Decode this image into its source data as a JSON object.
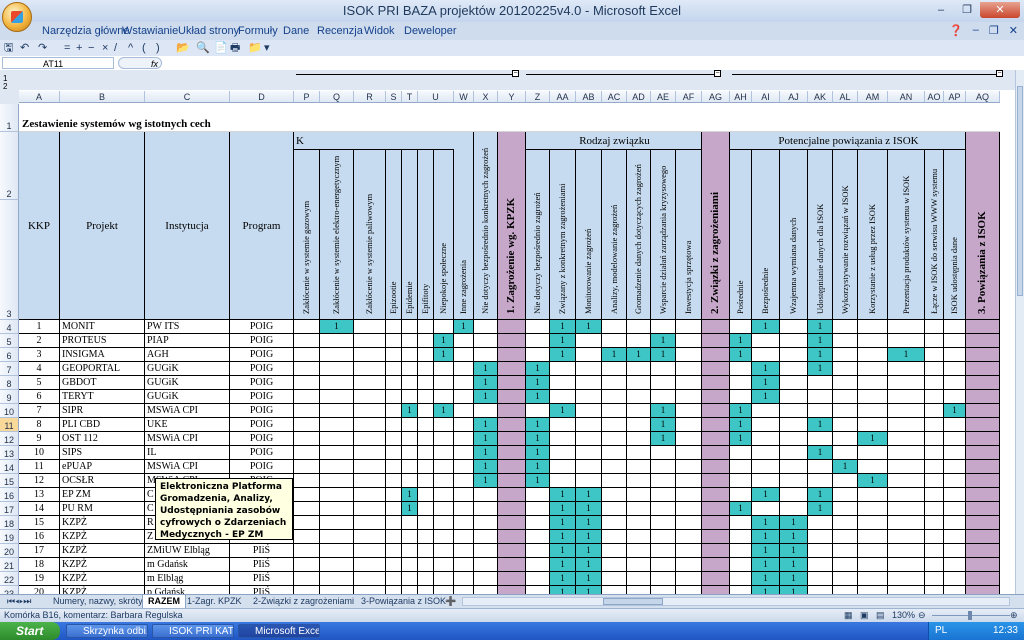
{
  "window": {
    "title": "ISOK PRI BAZA projektów 20120225v4.0 - Microsoft Excel"
  },
  "ribbon": {
    "tabs": [
      "Narzędzia główne",
      "Wstawianie",
      "Układ strony",
      "Formuły",
      "Dane",
      "Recenzja",
      "Widok",
      "Deweloper"
    ]
  },
  "formula_bar": {
    "name_box": "AT11",
    "fx": "fx",
    "value": ""
  },
  "columns": [
    "A",
    "B",
    "C",
    "D",
    "P",
    "Q",
    "R",
    "S",
    "T",
    "U",
    "W",
    "X",
    "Y",
    "Z",
    "AA",
    "AB",
    "AC",
    "AD",
    "AE",
    "AF",
    "AG",
    "AH",
    "AI",
    "AJ",
    "AK",
    "AL",
    "AM",
    "AN",
    "AO",
    "AP",
    "AQ"
  ],
  "outline_levels": [
    "1",
    "2"
  ],
  "rows_visible": [
    "1",
    "2",
    "3",
    "4",
    "5",
    "6",
    "7",
    "8",
    "9",
    "10",
    "11",
    "12",
    "13",
    "14",
    "15",
    "16",
    "17",
    "18",
    "19",
    "20",
    "21",
    "22",
    "23"
  ],
  "sheet": {
    "title": "Zestawienie systemów wg istotnych cech",
    "row2_groups": {
      "k_fragment": "K",
      "rodzaj": "Rodzaj związku",
      "potencjalne": "Potencjalne powiązania z ISOK"
    },
    "headers": {
      "kkp": "KKP",
      "projekt": "Projekt",
      "instytucja": "Instytucja",
      "program": "Program",
      "P": "Zakłócenie w systemie gazowym",
      "Q": "Zakłócenie w systemie elektro-energetycznym",
      "R": "Zakłócenie w systemie paliwowym",
      "S": "Epizootie",
      "T": "Epidemie",
      "U": "Epifitoty",
      "V": "Niepokoje społeczne",
      "W": "Inne zagrożenia",
      "X": "Nie dotyczy bezpośrednio konkretnych zagrożeń",
      "Y": "1. Zagrożenie wg. KPZK",
      "Z": "Nie dotyczy bezpośrednio zagrożeń",
      "AA": "Związany z konkretnym zagrożeniami",
      "AB": "Monitorowanie zagrożeń",
      "AC": "Analizy, modelowanie zagrożeń",
      "AD": "Gromadzenie danych dotyczących zagrożeń",
      "AE": "Wsparcie działań zarządzania kryzysowego",
      "AF": "Inwestycja sprzętowa",
      "AG": "2. Związki z zagrożeniami",
      "AH": "Pośrednie",
      "AI": "Bezpośrednie",
      "AJ": "Wzajemna wymiana danych",
      "AK": "Udostępnianie danych dla ISOK",
      "AL": "Wykorzystywanie rozwiązań w ISOK",
      "AM": "Korzystanie z usług przez ISOK",
      "AN": "Prezentacja produktów systemu w ISOK",
      "AO": "Łącze w ISOK do serwisu WWW systemu",
      "AP": "ISOK udostępnia dane",
      "AQ": "3. Powiązania z ISOK"
    },
    "rows": [
      {
        "kkp": "1",
        "projekt": "MONIT",
        "instytucja": "PW ITS",
        "program": "POIG",
        "flags": {
          "Q": "1",
          "W": "1",
          "AA": "1",
          "AB": "1",
          "AI": "1",
          "AK": "1"
        }
      },
      {
        "kkp": "2",
        "projekt": "PROTEUS",
        "instytucja": "PIAP",
        "program": "POIG",
        "flags": {
          "V": "1",
          "AA": "1",
          "AE": "1",
          "AH": "1",
          "AK": "1"
        }
      },
      {
        "kkp": "3",
        "projekt": "INSIGMA",
        "instytucja": "AGH",
        "program": "POIG",
        "flags": {
          "V": "1",
          "AA": "1",
          "AC": "1",
          "AD": "1",
          "AE": "1",
          "AH": "1",
          "AK": "1",
          "AN": "1"
        }
      },
      {
        "kkp": "4",
        "projekt": "GEOPORTAL",
        "instytucja": "GUGiK",
        "program": "POIG",
        "flags": {
          "X": "1",
          "Z": "1",
          "AI": "1",
          "AK": "1"
        }
      },
      {
        "kkp": "5",
        "projekt": "GBDOT",
        "instytucja": "GUGiK",
        "program": "POIG",
        "flags": {
          "X": "1",
          "Z": "1",
          "AI": "1"
        }
      },
      {
        "kkp": "6",
        "projekt": "TERYT",
        "instytucja": "GUGiK",
        "program": "POIG",
        "flags": {
          "X": "1",
          "Z": "1",
          "AI": "1"
        }
      },
      {
        "kkp": "7",
        "projekt": "SIPR",
        "instytucja": "MSWiA CPI",
        "program": "POIG",
        "flags": {
          "T": "1",
          "V": "1",
          "AA": "1",
          "AE": "1",
          "AH": "1",
          "AP": "1"
        }
      },
      {
        "kkp": "8",
        "projekt": "PLI CBD",
        "instytucja": "UKE",
        "program": "POIG",
        "flags": {
          "X": "1",
          "Z": "1",
          "AE": "1",
          "AH": "1",
          "AK": "1"
        }
      },
      {
        "kkp": "9",
        "projekt": "OST 112",
        "instytucja": "MSWiA CPI",
        "program": "POIG",
        "flags": {
          "X": "1",
          "Z": "1",
          "AE": "1",
          "AH": "1",
          "AM": "1"
        }
      },
      {
        "kkp": "10",
        "projekt": "SIPS",
        "instytucja": "IL",
        "program": "POIG",
        "flags": {
          "X": "1",
          "Z": "1",
          "AK": "1"
        }
      },
      {
        "kkp": "11",
        "projekt": "ePUAP",
        "instytucja": "MSWiA CPI",
        "program": "POIG",
        "flags": {
          "X": "1",
          "Z": "1",
          "AL": "1"
        }
      },
      {
        "kkp": "12",
        "projekt": "OCSŁR",
        "instytucja": "MSWiA CPI",
        "program": "POIG",
        "flags": {
          "X": "1",
          "Z": "1",
          "AM": "1"
        }
      },
      {
        "kkp": "13",
        "projekt": "EP ZM",
        "instytucja": "C",
        "program": "POIG",
        "flags": {
          "T": "1",
          "AA": "1",
          "AB": "1",
          "AI": "1",
          "AK": "1"
        }
      },
      {
        "kkp": "14",
        "projekt": "PU RM",
        "instytucja": "C",
        "program": "POIG",
        "flags": {
          "T": "1",
          "AA": "1",
          "AB": "1",
          "AH": "1",
          "AK": "1"
        }
      },
      {
        "kkp": "15",
        "projekt": "KZPŻ",
        "instytucja": "R",
        "program": "PIiŚ",
        "flags": {
          "AA": "1",
          "AB": "1",
          "AI": "1",
          "AJ": "1"
        }
      },
      {
        "kkp": "16",
        "projekt": "KZPŻ",
        "instytucja": "Z",
        "program": "PIiŚ",
        "flags": {
          "AA": "1",
          "AB": "1",
          "AI": "1",
          "AJ": "1"
        }
      },
      {
        "kkp": "17",
        "projekt": "KZPŻ",
        "instytucja": "ZMiUW Elbląg",
        "program": "PIiŚ",
        "flags": {
          "AA": "1",
          "AB": "1",
          "AI": "1",
          "AJ": "1"
        }
      },
      {
        "kkp": "18",
        "projekt": "KZPŻ",
        "instytucja": "m Gdańsk",
        "program": "PIiŚ",
        "flags": {
          "AA": "1",
          "AB": "1",
          "AI": "1",
          "AJ": "1"
        }
      },
      {
        "kkp": "19",
        "projekt": "KZPŻ",
        "instytucja": "m Elbląg",
        "program": "PIiŚ",
        "flags": {
          "AA": "1",
          "AB": "1",
          "AI": "1",
          "AJ": "1"
        }
      },
      {
        "kkp": "20",
        "projekt": "KZPŻ",
        "instytucja": "p Gdańsk",
        "program": "PIiŚ",
        "flags": {
          "AA": "1",
          "AB": "1",
          "AI": "1",
          "AJ": "1"
        }
      }
    ]
  },
  "comment": {
    "text": "Elektroniczna Platforma Gromadzenia, Analizy, Udostępniania zasobów cyfrowych o Zdarzeniach Medycznych - EP ZM"
  },
  "sheet_tabs": [
    "Numery, nazwy, skróty",
    "RAZEM",
    "1-Zagr. KPZK",
    "2-Związki z zagrożeniami",
    "3-Powiązania z ISOK"
  ],
  "status": {
    "text": "Komórka B16, komentarz: Barbara Regulska",
    "zoom": "130%"
  },
  "taskbar": {
    "start": "Start",
    "tasks": [
      "Skrzynka odbi...",
      "ISOK PRI KAT...",
      "Microsoft Exce..."
    ],
    "clock": "12:33",
    "lang": "PL"
  },
  "colors": {
    "teal": "#3ec6c6",
    "header_blue": "#c6dbf0",
    "purple": "#c7a7c9"
  }
}
